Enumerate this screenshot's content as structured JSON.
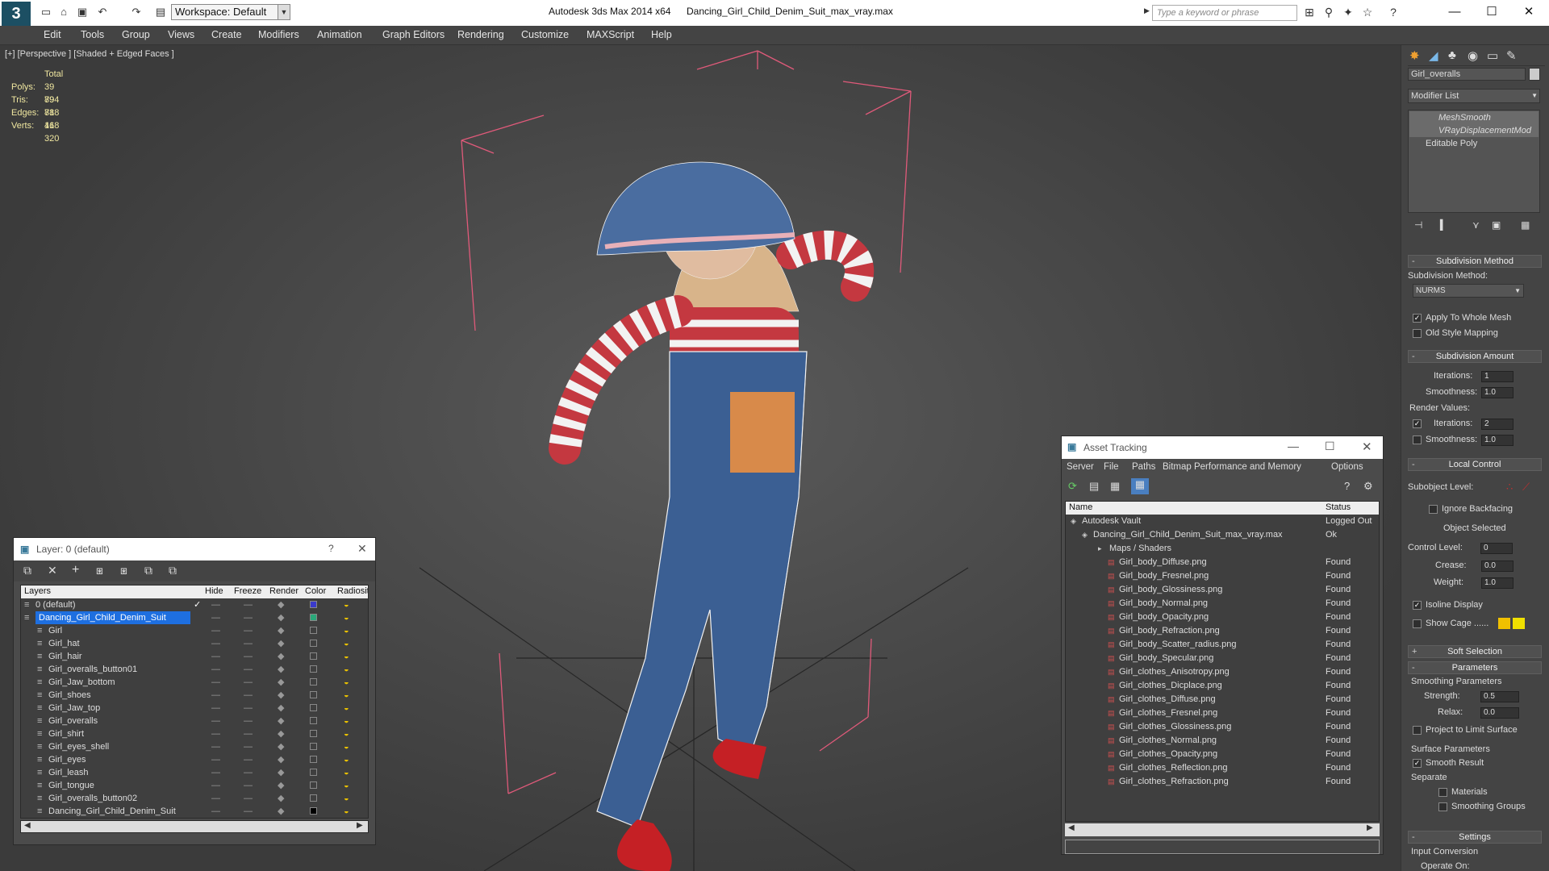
{
  "titlebar": {
    "logo": "3",
    "workspace": "Workspace: Default",
    "app_title": "Autodesk 3ds Max  2014 x64",
    "doc_title": "Dancing_Girl_Child_Denim_Suit_max_vray.max",
    "search_placeholder": "Type a keyword or phrase"
  },
  "menu": [
    "Edit",
    "Tools",
    "Group",
    "Views",
    "Create",
    "Modifiers",
    "Animation",
    "Graph Editors",
    "Rendering",
    "Customize",
    "MAXScript",
    "Help"
  ],
  "viewport": {
    "label": "[+] [Perspective ] [Shaded + Edged Faces ]",
    "stats_header": "Total",
    "stats": [
      {
        "k": "Polys:",
        "v": "39 894"
      },
      {
        "k": "Tris:",
        "v": "79 788"
      },
      {
        "k": "Edges:",
        "v": "81 168"
      },
      {
        "k": "Verts:",
        "v": "41 320"
      }
    ]
  },
  "command_panel": {
    "object_name": "Girl_overalls",
    "modifier_list": "Modifier List",
    "stack": [
      "MeshSmooth",
      "VRayDisplacementMod",
      "Editable Poly"
    ],
    "subdivision_method": {
      "title": "Subdivision Method",
      "label": "Subdivision Method:",
      "value": "NURMS",
      "apply_whole": "Apply To Whole Mesh",
      "old_style": "Old Style Mapping"
    },
    "subdivision_amount": {
      "title": "Subdivision Amount",
      "iterations_label": "Iterations:",
      "iterations": "1",
      "smoothness_label": "Smoothness:",
      "smoothness": "1.0",
      "render_values": "Render Values:",
      "r_iterations": "2",
      "r_smoothness": "1.0"
    },
    "local_control": {
      "title": "Local Control",
      "subobject": "Subobject Level:",
      "ignore_backfacing": "Ignore Backfacing",
      "object_selected": "Object Selected",
      "control_level_label": "Control Level:",
      "control_level": "0",
      "crease_label": "Crease:",
      "crease": "0.0",
      "weight_label": "Weight:",
      "weight": "1.0",
      "isoline": "Isoline Display",
      "show_cage": "Show Cage ......"
    },
    "soft_selection": "Soft Selection",
    "parameters": {
      "title": "Parameters",
      "smoothing_params": "Smoothing Parameters",
      "strength_label": "Strength:",
      "strength": "0.5",
      "relax_label": "Relax:",
      "relax": "0.0",
      "project": "Project to Limit Surface",
      "surface_params": "Surface Parameters",
      "smooth_result": "Smooth Result",
      "separate": "Separate",
      "materials": "Materials",
      "smoothing_groups": "Smoothing Groups"
    },
    "settings": {
      "title": "Settings",
      "input_conversion": "Input Conversion",
      "operate_on": "Operate On:"
    }
  },
  "layer_dialog": {
    "title": "Layer: 0 (default)",
    "help": "?",
    "columns": [
      "Layers",
      "Hide",
      "Freeze",
      "Render",
      "Color",
      "Radiosit"
    ],
    "rows": [
      {
        "name": "0 (default)",
        "color": "#3a3acc",
        "level": 0,
        "check": true
      },
      {
        "name": "Dancing_Girl_Child_Denim_Suit",
        "color": "#2aa87a",
        "level": 0,
        "selected": true
      },
      {
        "name": "Girl",
        "color": "",
        "level": 1
      },
      {
        "name": "Girl_hat",
        "color": "",
        "level": 1
      },
      {
        "name": "Girl_hair",
        "color": "",
        "level": 1
      },
      {
        "name": "Girl_overalls_button01",
        "color": "",
        "level": 1
      },
      {
        "name": "Girl_Jaw_bottom",
        "color": "",
        "level": 1
      },
      {
        "name": "Girl_shoes",
        "color": "",
        "level": 1
      },
      {
        "name": "Girl_Jaw_top",
        "color": "",
        "level": 1
      },
      {
        "name": "Girl_overalls",
        "color": "",
        "level": 1
      },
      {
        "name": "Girl_shirt",
        "color": "",
        "level": 1
      },
      {
        "name": "Girl_eyes_shell",
        "color": "",
        "level": 1
      },
      {
        "name": "Girl_eyes",
        "color": "",
        "level": 1
      },
      {
        "name": "Girl_leash",
        "color": "",
        "level": 1
      },
      {
        "name": "Girl_tongue",
        "color": "",
        "level": 1
      },
      {
        "name": "Girl_overalls_button02",
        "color": "",
        "level": 1
      },
      {
        "name": "Dancing_Girl_Child_Denim_Suit",
        "color": "#000000",
        "level": 1
      }
    ]
  },
  "asset_dialog": {
    "title": "Asset Tracking",
    "menu": [
      "Server",
      "File",
      "Paths",
      "Bitmap Performance and Memory",
      "Options"
    ],
    "columns": [
      "Name",
      "Status"
    ],
    "rows": [
      {
        "name": "Autodesk Vault",
        "status": "Logged Out",
        "level": 0
      },
      {
        "name": "Dancing_Girl_Child_Denim_Suit_max_vray.max",
        "status": "Ok",
        "level": 1
      },
      {
        "name": "Maps / Shaders",
        "status": "",
        "level": 2
      },
      {
        "name": "Girl_body_Diffuse.png",
        "status": "Found",
        "level": 3
      },
      {
        "name": "Girl_body_Fresnel.png",
        "status": "Found",
        "level": 3
      },
      {
        "name": "Girl_body_Glossiness.png",
        "status": "Found",
        "level": 3
      },
      {
        "name": "Girl_body_Normal.png",
        "status": "Found",
        "level": 3
      },
      {
        "name": "Girl_body_Opacity.png",
        "status": "Found",
        "level": 3
      },
      {
        "name": "Girl_body_Refraction.png",
        "status": "Found",
        "level": 3
      },
      {
        "name": "Girl_body_Scatter_radius.png",
        "status": "Found",
        "level": 3
      },
      {
        "name": "Girl_body_Specular.png",
        "status": "Found",
        "level": 3
      },
      {
        "name": "Girl_clothes_Anisotropy.png",
        "status": "Found",
        "level": 3
      },
      {
        "name": "Girl_clothes_Dicplace.png",
        "status": "Found",
        "level": 3
      },
      {
        "name": "Girl_clothes_Diffuse.png",
        "status": "Found",
        "level": 3
      },
      {
        "name": "Girl_clothes_Fresnel.png",
        "status": "Found",
        "level": 3
      },
      {
        "name": "Girl_clothes_Glossiness.png",
        "status": "Found",
        "level": 3
      },
      {
        "name": "Girl_clothes_Normal.png",
        "status": "Found",
        "level": 3
      },
      {
        "name": "Girl_clothes_Opacity.png",
        "status": "Found",
        "level": 3
      },
      {
        "name": "Girl_clothes_Reflection.png",
        "status": "Found",
        "level": 3
      },
      {
        "name": "Girl_clothes_Refraction.png",
        "status": "Found",
        "level": 3
      }
    ]
  },
  "colors": {
    "cage_1": "#f0c000",
    "cage_2": "#f0e000",
    "selection": "#1e6fe0",
    "bbox": "#e05a7a",
    "stats": "#f0e7a0"
  }
}
